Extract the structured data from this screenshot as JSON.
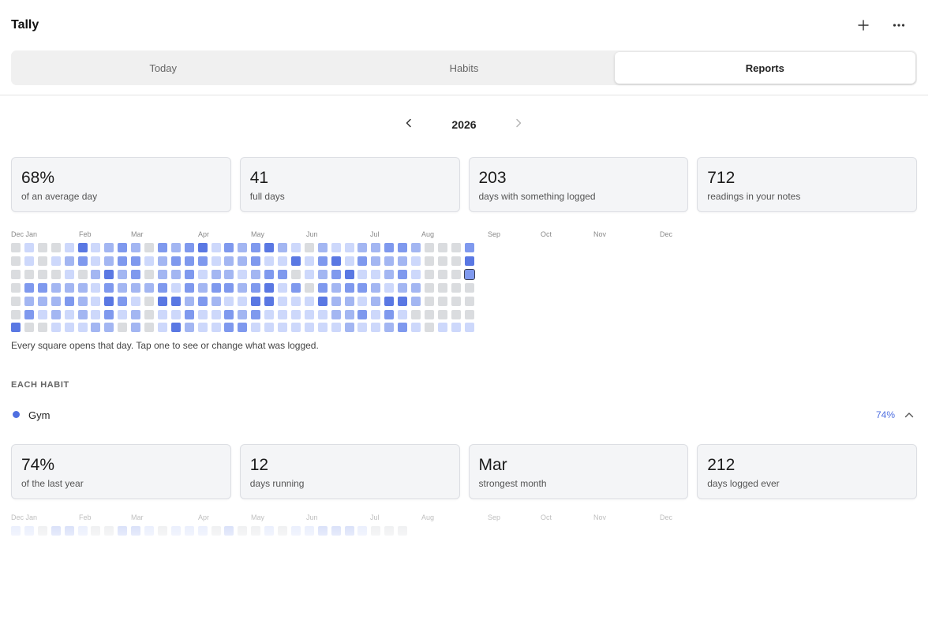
{
  "app": {
    "title": "Tally"
  },
  "toolbar": {
    "add_icon": "plus-icon",
    "more_icon": "more-horizontal-icon"
  },
  "tabs": [
    {
      "label": "Today",
      "active": false
    },
    {
      "label": "Habits",
      "active": false
    },
    {
      "label": "Reports",
      "active": true
    }
  ],
  "year_nav": {
    "year": "2026",
    "prev_icon": "chevron-left-icon",
    "next_icon": "chevron-right-icon"
  },
  "summary": [
    {
      "value": "68%",
      "label": "of an average day"
    },
    {
      "value": "41",
      "label": "full days"
    },
    {
      "value": "203",
      "label": "days with something logged"
    },
    {
      "value": "712",
      "label": "readings in your notes"
    }
  ],
  "heatmap": {
    "months": [
      "Dec Jan",
      "Feb",
      "Mar",
      "Apr",
      "May",
      "Jun",
      "Jul",
      "Aug",
      "Sep",
      "Oct",
      "Nov",
      "Dec"
    ],
    "levels": [
      [
        0,
        0,
        0,
        0,
        0,
        0,
        4
      ],
      [
        1,
        1,
        0,
        3,
        2,
        3,
        0
      ],
      [
        0,
        0,
        0,
        3,
        2,
        1,
        0
      ],
      [
        0,
        1,
        0,
        2,
        2,
        2,
        1
      ],
      [
        1,
        2,
        1,
        2,
        3,
        1,
        1
      ],
      [
        4,
        3,
        0,
        2,
        2,
        2,
        1
      ],
      [
        1,
        1,
        2,
        1,
        1,
        1,
        2
      ],
      [
        2,
        2,
        4,
        3,
        4,
        3,
        2
      ],
      [
        3,
        3,
        2,
        2,
        3,
        1,
        0
      ],
      [
        2,
        3,
        3,
        2,
        1,
        2,
        2
      ],
      [
        0,
        1,
        0,
        2,
        0,
        0,
        0
      ],
      [
        3,
        2,
        2,
        3,
        4,
        1,
        1
      ],
      [
        2,
        3,
        2,
        1,
        4,
        1,
        4
      ],
      [
        3,
        3,
        3,
        3,
        2,
        3,
        2
      ],
      [
        4,
        3,
        1,
        2,
        3,
        1,
        1
      ],
      [
        1,
        1,
        2,
        3,
        2,
        1,
        1
      ],
      [
        3,
        2,
        2,
        3,
        1,
        3,
        3
      ],
      [
        2,
        2,
        1,
        2,
        1,
        2,
        3
      ],
      [
        3,
        3,
        2,
        3,
        4,
        3,
        1
      ],
      [
        4,
        1,
        3,
        4,
        4,
        1,
        1
      ],
      [
        2,
        1,
        3,
        1,
        1,
        1,
        1
      ],
      [
        1,
        4,
        0,
        3,
        1,
        1,
        1
      ],
      [
        0,
        1,
        1,
        0,
        1,
        1,
        1
      ],
      [
        2,
        3,
        2,
        3,
        4,
        1,
        1
      ],
      [
        1,
        4,
        3,
        2,
        2,
        2,
        1
      ],
      [
        1,
        1,
        4,
        3,
        2,
        2,
        2
      ],
      [
        2,
        3,
        1,
        3,
        1,
        3,
        1
      ],
      [
        2,
        2,
        1,
        2,
        2,
        1,
        1
      ],
      [
        3,
        2,
        2,
        1,
        4,
        3,
        2
      ],
      [
        3,
        2,
        3,
        2,
        4,
        1,
        3
      ],
      [
        2,
        1,
        1,
        2,
        2,
        0,
        1
      ],
      [
        0,
        0,
        0,
        0,
        0,
        0,
        0
      ],
      [
        0,
        0,
        0,
        0,
        0,
        0,
        1
      ],
      [
        0,
        0,
        0,
        0,
        0,
        0,
        1
      ],
      [
        3,
        4,
        3,
        0,
        0,
        0,
        1
      ]
    ],
    "selected": {
      "week": 34,
      "day": 2
    },
    "colors": [
      "#dadcdf",
      "#cdd8fb",
      "#a3b6f2",
      "#7f99ee",
      "#5a78e3"
    ]
  },
  "hint": "Every square opens that day. Tap one to see or change what was logged.",
  "section": {
    "title": "EACH HABIT"
  },
  "habit": {
    "name": "Gym",
    "color": "#4f6fe0",
    "percent": "74%",
    "chevron_icon": "chevron-up-icon",
    "stats": [
      {
        "value": "74%",
        "label": "of the last year"
      },
      {
        "value": "12",
        "label": "days running"
      },
      {
        "value": "Mar",
        "label": "strongest month"
      },
      {
        "value": "212",
        "label": "days logged ever"
      }
    ],
    "ghost_months": [
      "Dec Jan",
      "Feb",
      "Mar",
      "Apr",
      "May",
      "Jun",
      "Jul",
      "Aug",
      "Sep",
      "Oct",
      "Nov",
      "Dec"
    ],
    "ghost_row": [
      1,
      1,
      0,
      2,
      2,
      1,
      0,
      0,
      2,
      2,
      1,
      0,
      1,
      1,
      1,
      0,
      2,
      0,
      0,
      1,
      0,
      1,
      1,
      2,
      2,
      2,
      1,
      0,
      0,
      0
    ]
  }
}
